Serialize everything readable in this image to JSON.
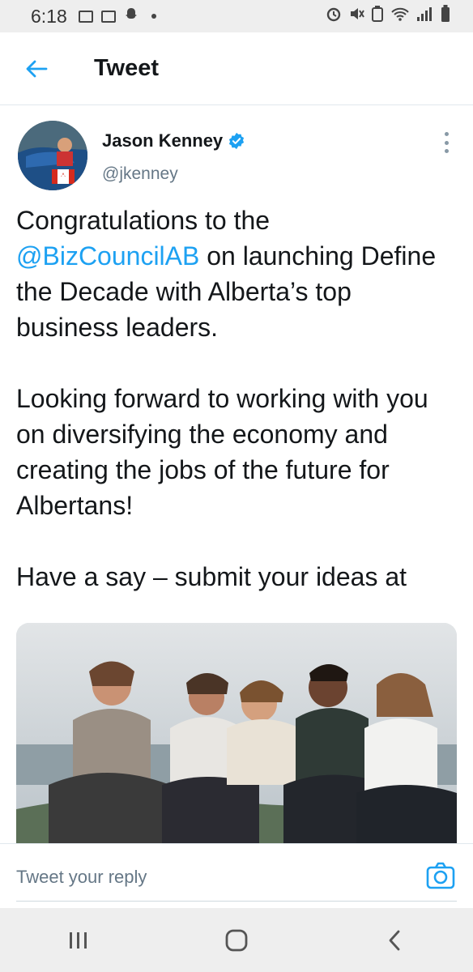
{
  "status_bar": {
    "time": "6:18"
  },
  "app_bar": {
    "title": "Tweet"
  },
  "tweet": {
    "author_name": "Jason Kenney",
    "author_handle": "@jkenney",
    "text": {
      "p1_before": "Congratulations to the ",
      "mention": "@BizCouncilAB",
      "p1_after": " on launching Define the Decade with Alberta’s top business leaders.",
      "p2": "Looking forward to working with you on diversifying the economy and creating the jobs of the future for Albertans!",
      "p3": "Have a say – submit your ideas at"
    }
  },
  "reply": {
    "placeholder": "Tweet your reply"
  },
  "colors": {
    "accent": "#1da1f2",
    "text": "#14171a",
    "secondary": "#657786"
  }
}
